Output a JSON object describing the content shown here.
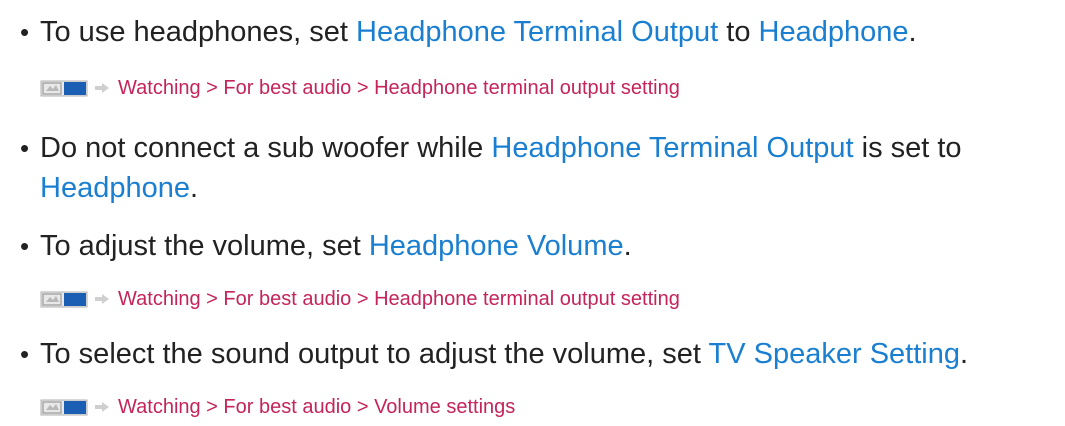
{
  "items": [
    {
      "parts": [
        {
          "text": "To use headphones, set ",
          "kind": "plain"
        },
        {
          "text": "Headphone Terminal Output",
          "kind": "term"
        },
        {
          "text": " to ",
          "kind": "plain"
        },
        {
          "text": "Headphone",
          "kind": "term"
        },
        {
          "text": ".",
          "kind": "plain"
        }
      ],
      "link": "Watching > For best audio > Headphone terminal output setting"
    },
    {
      "parts": [
        {
          "text": "Do not connect a sub woofer while ",
          "kind": "plain"
        },
        {
          "text": "Headphone Terminal Output",
          "kind": "term"
        },
        {
          "text": " is set to ",
          "kind": "plain"
        },
        {
          "text": "Headphone",
          "kind": "term"
        },
        {
          "text": ".",
          "kind": "plain"
        }
      ]
    },
    {
      "parts": [
        {
          "text": "To adjust the volume, set ",
          "kind": "plain"
        },
        {
          "text": "Headphone Volume",
          "kind": "term"
        },
        {
          "text": ".",
          "kind": "plain"
        }
      ],
      "link": "Watching > For best audio > Headphone terminal output setting"
    },
    {
      "parts": [
        {
          "text": "To select the sound output to adjust the volume, set ",
          "kind": "plain"
        },
        {
          "text": "TV Speaker Setting",
          "kind": "term"
        },
        {
          "text": ".",
          "kind": "plain"
        }
      ],
      "link": "Watching > For best audio > Volume settings"
    }
  ],
  "colors": {
    "text": "#222222",
    "term": "#1a7fd0",
    "link": "#c4245a"
  },
  "icons": {
    "bullet": "•",
    "menu_icon": "tv-menu-icon",
    "arrow_icon": "arrow-right-icon"
  }
}
